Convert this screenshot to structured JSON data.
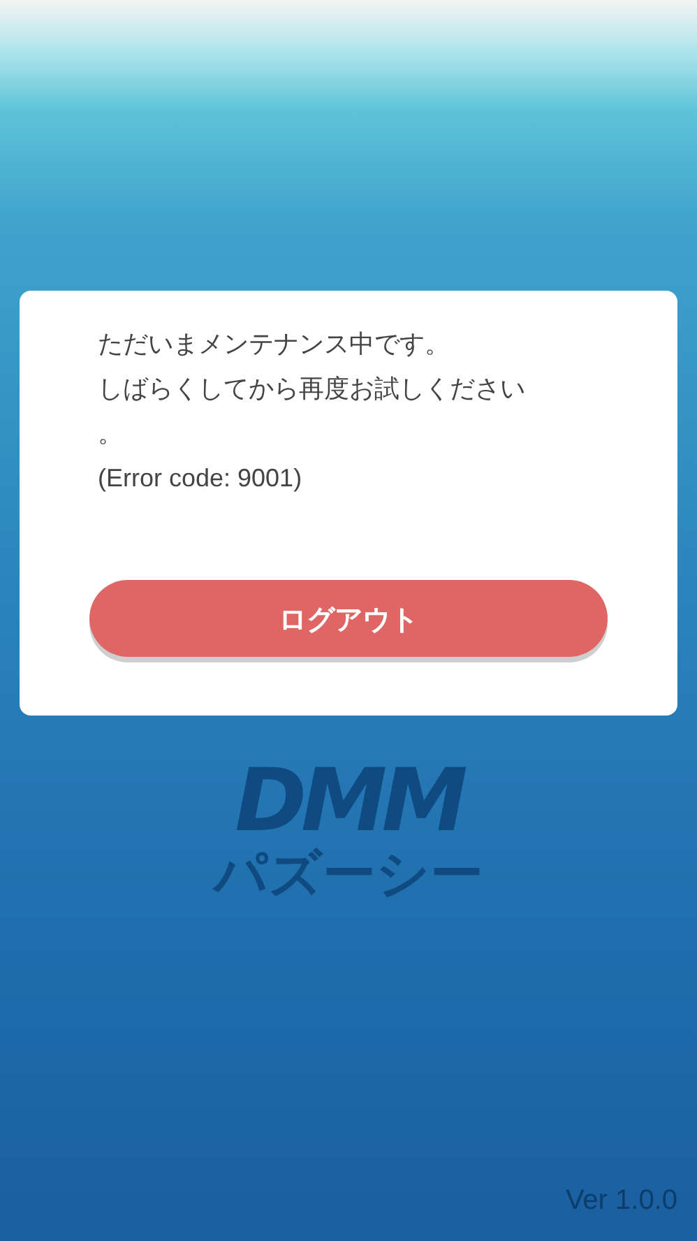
{
  "dialog": {
    "message_lines": [
      "ただいまメンテナンス中です。",
      "しばらくしてから再度お試しください",
      "。",
      "(Error code: 9001)"
    ],
    "button": {
      "label": "ログアウト"
    }
  },
  "logo": {
    "title": "DMM",
    "subtitle": "パズーシー"
  },
  "version": "Ver 1.0.0"
}
